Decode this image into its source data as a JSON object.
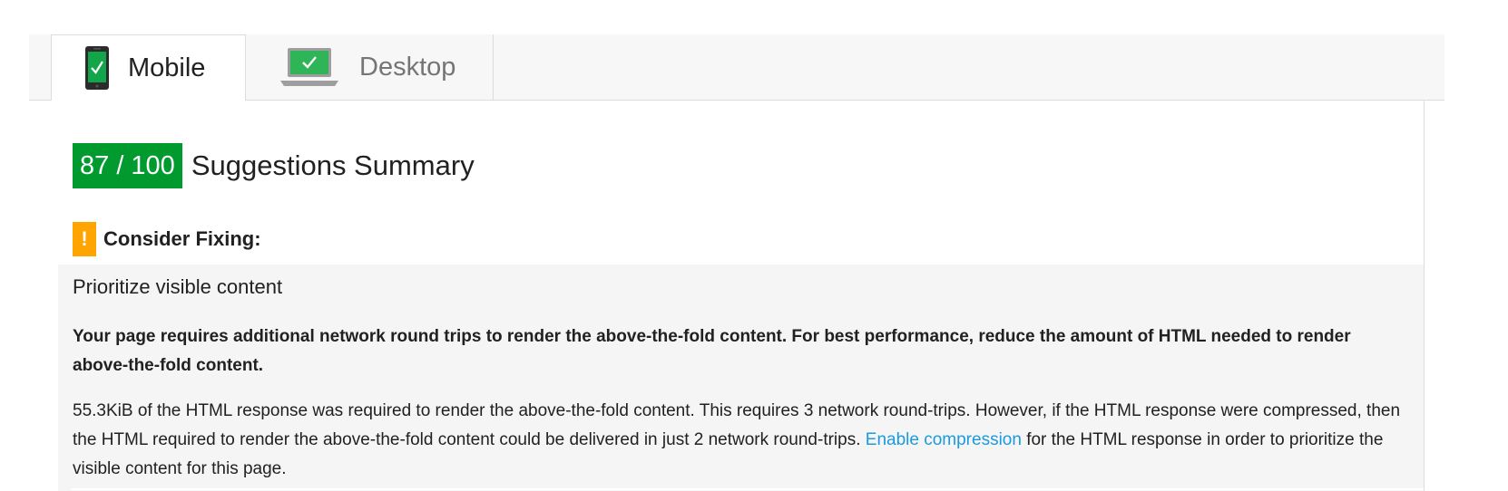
{
  "tabs": [
    {
      "label": "Mobile",
      "icon": "mobile-phone-check-icon",
      "selected": true
    },
    {
      "label": "Desktop",
      "icon": "laptop-check-icon",
      "selected": false
    }
  ],
  "score": {
    "value": "87 / 100",
    "color": "#009a2e",
    "title": "Suggestions Summary"
  },
  "section": {
    "icon": "warning-icon",
    "icon_glyph": "!",
    "label": "Consider Fixing:"
  },
  "rule": {
    "title": "Prioritize visible content",
    "summary": "Your page requires additional network round trips to render the above-the-fold content. For best performance, reduce the amount of HTML needed to render above-the-fold content.",
    "detail_before_link": "55.3KiB of the HTML response was required to render the above-the-fold content. This requires 3 network round-trips. However, if the HTML response were compressed, then the HTML required to render the above-the-fold content could be delivered in just 2 network round-trips. ",
    "link_text": "Enable compression",
    "detail_after_link": " for the HTML response in order to prioritize the visible content for this page."
  },
  "colors": {
    "accent_green": "#009a2e",
    "warning_orange": "#ffa400",
    "link_blue": "#1a9ae0"
  }
}
